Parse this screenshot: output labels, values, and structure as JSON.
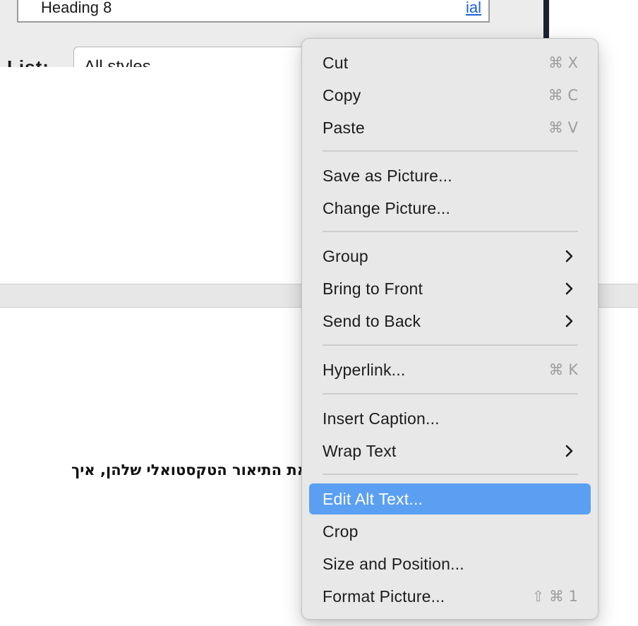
{
  "background": {
    "style_box_text": "Heading 8",
    "style_box_link": "ial",
    "list_label": "List:",
    "list_select_value": "All styles",
    "document_text": "את התיאור הטקסטואלי שלהן, איך"
  },
  "context_menu": {
    "items": [
      {
        "label": "Cut",
        "shortcut": "⌘ X"
      },
      {
        "label": "Copy",
        "shortcut": "⌘ C"
      },
      {
        "label": "Paste",
        "shortcut": "⌘ V"
      },
      {
        "label": "Save as Picture...",
        "shortcut": ""
      },
      {
        "label": "Change Picture...",
        "shortcut": ""
      },
      {
        "label": "Group",
        "submenu": true
      },
      {
        "label": "Bring to Front",
        "submenu": true
      },
      {
        "label": "Send to Back",
        "submenu": true
      },
      {
        "label": "Hyperlink...",
        "shortcut": "⌘ K"
      },
      {
        "label": "Insert Caption...",
        "shortcut": ""
      },
      {
        "label": "Wrap Text",
        "submenu": true
      },
      {
        "label": "Edit Alt Text...",
        "highlighted": true
      },
      {
        "label": "Crop",
        "shortcut": ""
      },
      {
        "label": "Size and Position...",
        "shortcut": ""
      },
      {
        "label": "Format Picture...",
        "shortcut": "⇧ ⌘ 1"
      }
    ]
  },
  "colors": {
    "menu_background": "#e8e8e8",
    "highlight": "#5a9ff2",
    "shortcut_text": "#9d9d9d"
  },
  "icons": {
    "submenu": "chevron-right-icon"
  }
}
